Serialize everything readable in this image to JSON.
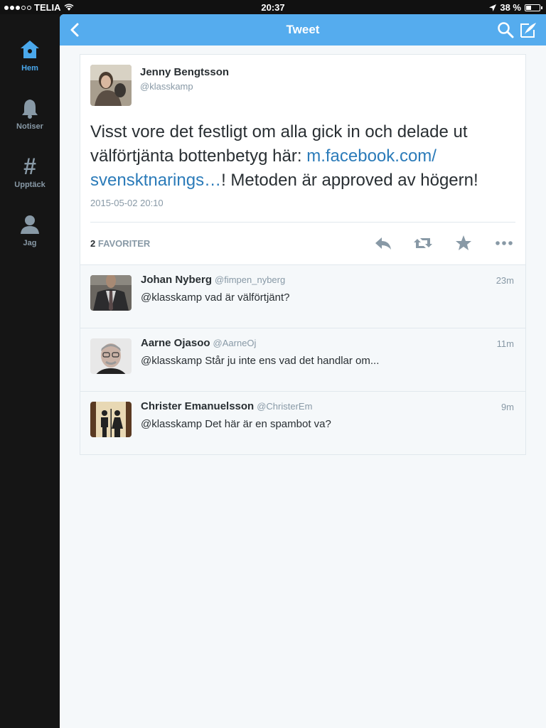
{
  "status_bar": {
    "carrier": "TELIA",
    "time": "20:37",
    "battery": "38 %",
    "battery_level": 0.38
  },
  "sidebar": {
    "items": [
      {
        "label": "Hem",
        "icon": "home-icon",
        "active": true
      },
      {
        "label": "Notiser",
        "icon": "bell-icon",
        "active": false
      },
      {
        "label": "Upptäck",
        "icon": "hashtag-icon",
        "active": false
      },
      {
        "label": "Jag",
        "icon": "person-icon",
        "active": false
      }
    ]
  },
  "navbar": {
    "title": "Tweet",
    "icons": [
      "back-icon",
      "search-icon",
      "compose-icon"
    ]
  },
  "tweet": {
    "name": "Jenny Bengtsson",
    "handle": "@klasskamp",
    "text_before": "Visst vore det festligt om alla gick in och delade ut välförtjänta bottenbetyg här: ",
    "link": "m.facebook.com/ svensktnarings…",
    "text_after": "! Metoden är approved av högern!",
    "date": "2015-05-02 20:10",
    "favorites_count": "2",
    "favorites_label": "FAVORITER",
    "actions": [
      "reply-icon",
      "retweet-icon",
      "favorite-icon",
      "more-icon"
    ]
  },
  "replies": [
    {
      "name": "Johan Nyberg",
      "handle": "@fimpen_nyberg",
      "time": "23m",
      "text": "@klasskamp vad är välförtjänt?"
    },
    {
      "name": "Aarne Ojasoo",
      "handle": "@AarneOj",
      "time": "11m",
      "text": "@klasskamp Står ju inte ens vad det handlar om..."
    },
    {
      "name": "Christer Emanuelsson",
      "handle": "@ChristerEm",
      "time": "9m",
      "text": "@klasskamp Det här är en spambot va?"
    }
  ],
  "colors": {
    "accent": "#55acee",
    "link": "#2b7bb9",
    "sidebar_active": "#4aa8ec"
  }
}
